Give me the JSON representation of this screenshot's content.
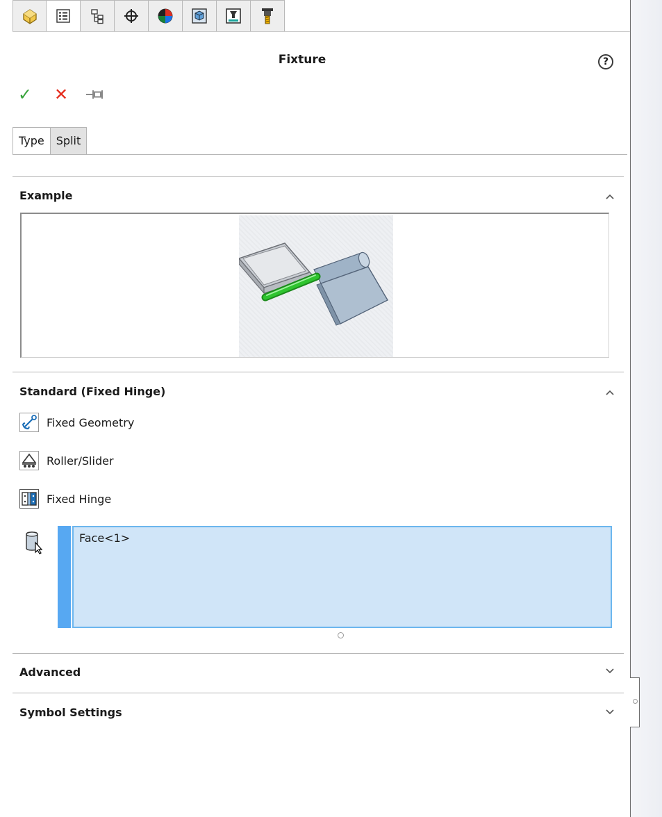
{
  "tabs": [
    {
      "icon": "part-icon",
      "active": false
    },
    {
      "icon": "property-manager-icon",
      "active": true
    },
    {
      "icon": "configuration-manager-icon",
      "active": false
    },
    {
      "icon": "dimxpert-icon",
      "active": false
    },
    {
      "icon": "display-manager-icon",
      "active": false
    },
    {
      "icon": "cam-feature-tree-icon",
      "active": false
    },
    {
      "icon": "cam-operation-tree-icon",
      "active": false
    },
    {
      "icon": "cam-tools-tree-icon",
      "active": false
    }
  ],
  "header": {
    "title": "Fixture",
    "help_icon": "?"
  },
  "actions": {
    "ok": "✓",
    "cancel": "✕"
  },
  "subtabs": [
    {
      "label": "Type",
      "active": true
    },
    {
      "label": "Split",
      "active": false
    }
  ],
  "sections": {
    "example": {
      "title": "Example",
      "expanded": true
    },
    "standard": {
      "title": "Standard (Fixed Hinge)",
      "expanded": true,
      "options": [
        {
          "label": "Fixed Geometry",
          "icon": "fixed-geometry-icon"
        },
        {
          "label": "Roller/Slider",
          "icon": "roller-slider-icon"
        },
        {
          "label": "Fixed Hinge",
          "icon": "fixed-hinge-icon"
        }
      ],
      "selection_items": [
        "Face<1>"
      ]
    },
    "advanced": {
      "title": "Advanced",
      "expanded": false
    },
    "symbol_settings": {
      "title": "Symbol Settings",
      "expanded": false
    }
  },
  "colors": {
    "accept": "#38a33b",
    "cancel": "#e52b1c",
    "selection_bg": "#d0e5f8",
    "selection_border": "#6cb6ee",
    "hinge_highlight": "#2fc42f"
  }
}
